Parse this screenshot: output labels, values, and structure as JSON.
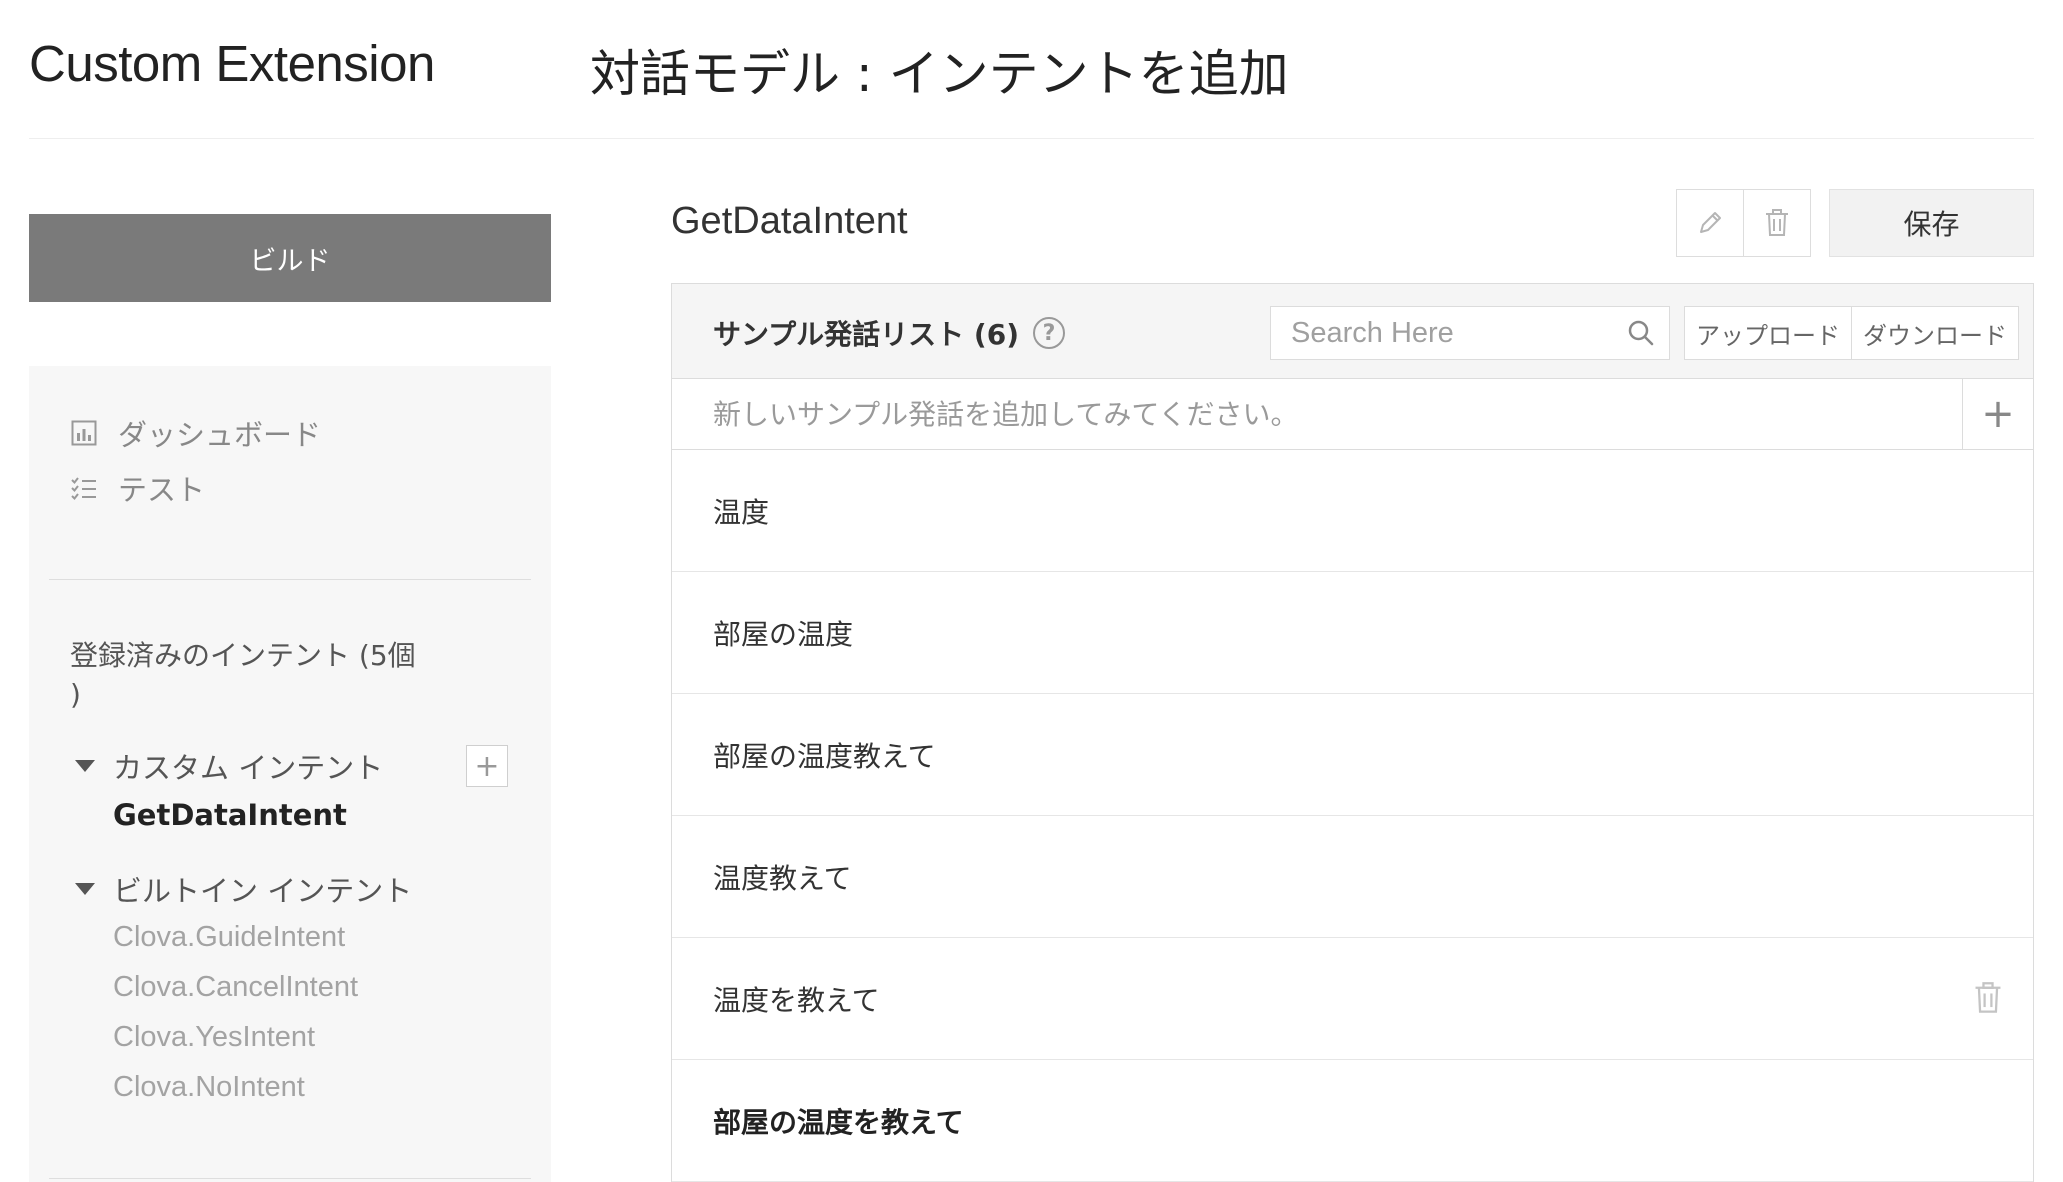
{
  "header": {
    "app_title": "Custom Extension",
    "page_title": "対話モデル : インテントを追加"
  },
  "sidebar": {
    "build_label": "ビルド",
    "nav": [
      {
        "label": "ダッシュボード",
        "icon": "chart-icon"
      },
      {
        "label": "テスト",
        "icon": "checklist-icon"
      }
    ],
    "intents_heading_line1": "登録済みのインテント (5個",
    "intents_heading_line2": ")",
    "custom_group_label": "カスタム インテント",
    "custom_intents": [
      "GetDataIntent"
    ],
    "builtin_group_label": "ビルトイン インテント",
    "builtin_intents": [
      "Clova.GuideIntent",
      "Clova.CancelIntent",
      "Clova.YesIntent",
      "Clova.NoIntent"
    ]
  },
  "main": {
    "intent_name": "GetDataIntent",
    "save_label": "保存",
    "list_title": "サンプル発話リスト (6)",
    "search_placeholder": "Search Here",
    "upload_label": "アップロード",
    "download_label": "ダウンロード",
    "add_placeholder": "新しいサンプル発話を追加してみてください。",
    "add_symbol": "+",
    "utterances": [
      "温度",
      "部屋の温度",
      "部屋の温度教えて",
      "温度教えて",
      "温度を教えて",
      "部屋の温度を教えて"
    ]
  },
  "colors": {
    "build_button": "#7a7a7a",
    "sidebar_bg": "#f7f7f7",
    "header_bg": "#f5f5f5",
    "border": "#dcdcdc"
  }
}
